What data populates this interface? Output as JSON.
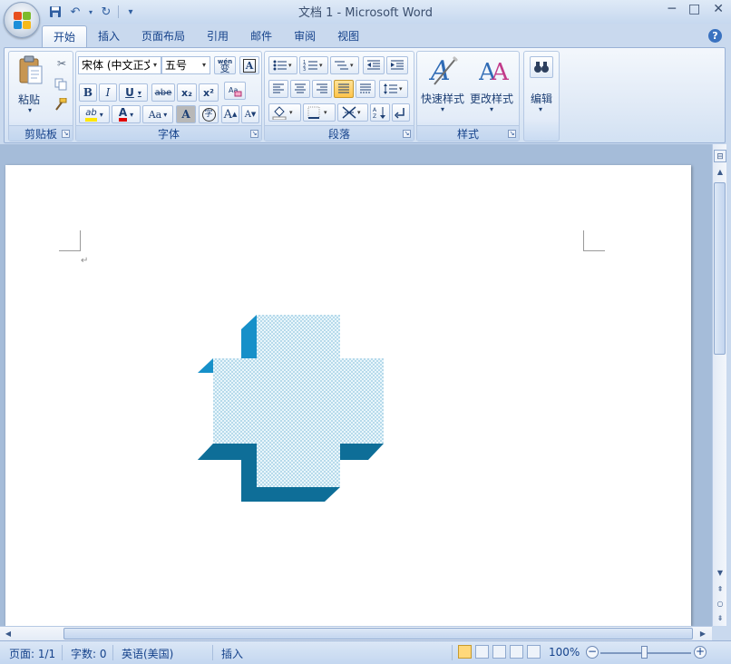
{
  "window": {
    "title": "文档 1 - Microsoft Word",
    "controls": {
      "minimize": "─",
      "maximize": "□",
      "close": "✕"
    }
  },
  "quick_access": {
    "save_icon": "save-icon",
    "undo": "↶",
    "redo": "↻",
    "customize": "▾"
  },
  "tabs": [
    {
      "label": "开始",
      "active": true
    },
    {
      "label": "插入"
    },
    {
      "label": "页面布局"
    },
    {
      "label": "引用"
    },
    {
      "label": "邮件"
    },
    {
      "label": "审阅"
    },
    {
      "label": "视图"
    }
  ],
  "help": "?",
  "ribbon": {
    "clipboard": {
      "label": "剪贴板",
      "paste": "粘贴"
    },
    "font": {
      "label": "字体",
      "font_name": "宋体 (中文正文",
      "font_size": "五号",
      "pinyin": "wén",
      "bold": "B",
      "italic": "I",
      "underline": "U",
      "strike": "abe",
      "subscript": "x₂",
      "superscript": "x²",
      "highlight": "ab",
      "fontcolor": "A",
      "change_case": "Aa",
      "char_shading": "A",
      "enclose": "字",
      "grow": "A",
      "shrink": "A"
    },
    "paragraph": {
      "label": "段落"
    },
    "styles": {
      "label": "样式",
      "quick_styles": "快速样式",
      "change_styles": "更改样式"
    },
    "editing": {
      "label": "编辑"
    }
  },
  "document": {
    "paragraph_mark": "↵",
    "shape_fill": "#e9f6fb",
    "shape_side": "#1690c9",
    "shape_bottom": "#0e6e98"
  },
  "status": {
    "page": "页面: 1/1",
    "words": "字数: 0",
    "language": "英语(美国)",
    "mode": "插入",
    "zoom": "100%",
    "zoom_level": 100
  },
  "colors": {
    "accent": "#15428b",
    "highlight": "#ffe600",
    "font_red": "#e00000"
  }
}
